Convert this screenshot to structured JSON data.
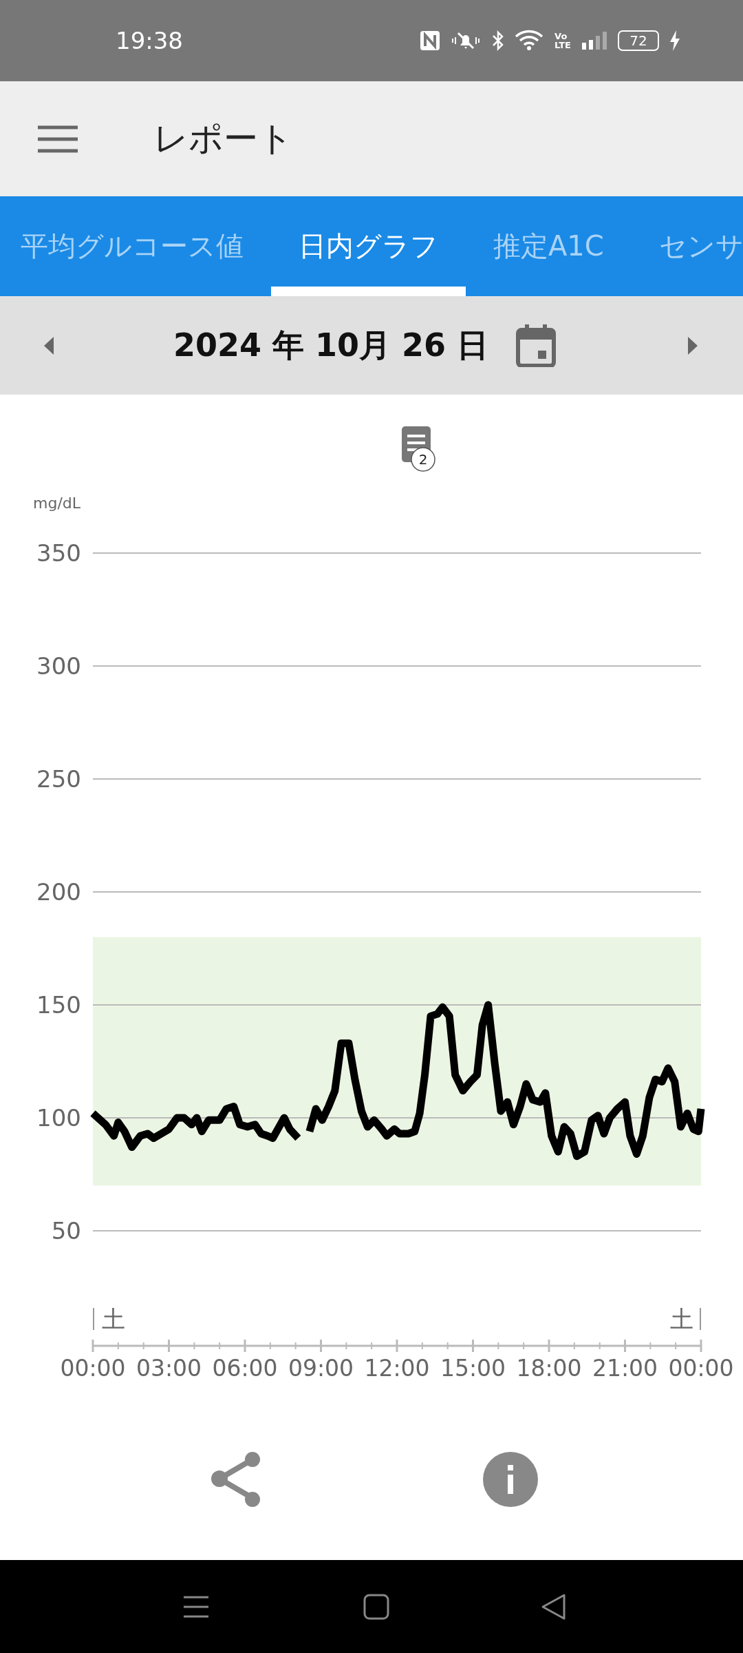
{
  "status_bar": {
    "time": "19:38",
    "network_label": [
      "Vo",
      "LTE"
    ],
    "battery": "72"
  },
  "app_bar": {
    "title": "レポート"
  },
  "tabs": [
    {
      "label": "平均グルコース値",
      "selected": false
    },
    {
      "label": "日内グラフ",
      "selected": true
    },
    {
      "label": "推定A1C",
      "selected": false
    },
    {
      "label": "センサ",
      "selected": false
    }
  ],
  "date_bar": {
    "date": "2024 年 10月 26 日"
  },
  "chart": {
    "note_badge": "2",
    "day_labels": [
      "土",
      "土"
    ],
    "chart_data": {
      "type": "line",
      "ylabel": "mg/dL",
      "xlim": [
        0,
        24
      ],
      "ylim": [
        0,
        350
      ],
      "yticks": [
        50,
        100,
        150,
        200,
        250,
        300,
        350
      ],
      "xticks": [
        {
          "value": 0,
          "label": "00:00"
        },
        {
          "value": 3,
          "label": "03:00"
        },
        {
          "value": 6,
          "label": "06:00"
        },
        {
          "value": 9,
          "label": "09:00"
        },
        {
          "value": 12,
          "label": "12:00"
        },
        {
          "value": 15,
          "label": "15:00"
        },
        {
          "value": 18,
          "label": "18:00"
        },
        {
          "value": 21,
          "label": "21:00"
        },
        {
          "value": 24,
          "label": "00:00"
        }
      ],
      "grid": true,
      "bands": [
        {
          "axis": "y",
          "from": 70,
          "to": 180,
          "color": "#ebf5e3"
        }
      ],
      "x": [
        0,
        0.5,
        0.83,
        1.0,
        1.25,
        1.54,
        1.87,
        2.16,
        2.4,
        2.7,
        3.0,
        3.32,
        3.6,
        3.9,
        4.1,
        4.3,
        4.57,
        5.0,
        5.27,
        5.56,
        5.8,
        6.1,
        6.4,
        6.64,
        6.9,
        7.1,
        7.35,
        7.55,
        7.77,
        8.1,
        8.3,
        8.55,
        8.8,
        9.05,
        9.3,
        9.55,
        9.8,
        10.1,
        10.34,
        10.6,
        10.84,
        11.1,
        11.4,
        11.6,
        11.9,
        12.1,
        12.45,
        12.7,
        12.9,
        13.1,
        13.33,
        13.6,
        13.8,
        14.07,
        14.3,
        14.6,
        14.9,
        15.16,
        15.37,
        15.6,
        15.86,
        16.1,
        16.36,
        16.6,
        16.86,
        17.1,
        17.36,
        17.65,
        17.86,
        18.1,
        18.36,
        18.6,
        18.85,
        19.1,
        19.4,
        19.68,
        19.93,
        20.17,
        20.4,
        20.7,
        21.0,
        21.2,
        21.46,
        21.7,
        21.96,
        22.2,
        22.46,
        22.7,
        22.96,
        23.2,
        23.46,
        23.7,
        23.9,
        24.0
      ],
      "series": [
        {
          "color": "#000000",
          "values": [
            102,
            97,
            92,
            98,
            94,
            87,
            92,
            93,
            91,
            93,
            95,
            100,
            100,
            97,
            100,
            94,
            99,
            99,
            104,
            105,
            97,
            96,
            97,
            93,
            92,
            91,
            96,
            100,
            95,
            91,
            null,
            94,
            104,
            99,
            105,
            112,
            133,
            133,
            117,
            103,
            96,
            99,
            95,
            92,
            95,
            93,
            93,
            94,
            102,
            119,
            145,
            146,
            149,
            145,
            119,
            112,
            116,
            119,
            141,
            150,
            124,
            103,
            107,
            97,
            105,
            115,
            108,
            107,
            111,
            92,
            85,
            96,
            93,
            83,
            85,
            99,
            101,
            93,
            100,
            104,
            107,
            92,
            84,
            92,
            109,
            117,
            116,
            122,
            116,
            96,
            102,
            95,
            94,
            104
          ]
        }
      ]
    }
  }
}
